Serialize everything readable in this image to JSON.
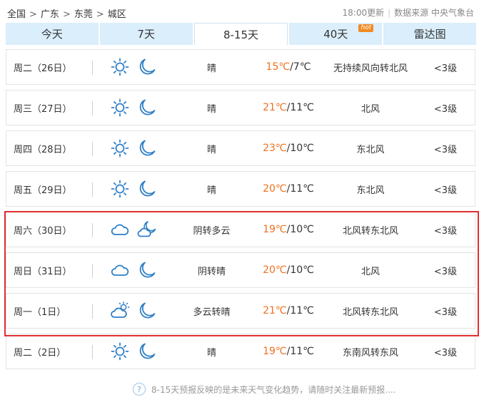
{
  "breadcrumb": [
    "全国",
    "广东",
    "东莞",
    "城区"
  ],
  "breadcrumb_sep": ">",
  "updated": "18:00更新",
  "source": "数据来源 中央气象台",
  "tabs": [
    {
      "label": "今天"
    },
    {
      "label": "7天"
    },
    {
      "label": "8-15天",
      "active": true
    },
    {
      "label": "40天",
      "badge": "hot"
    },
    {
      "label": "雷达图"
    }
  ],
  "rows": [
    {
      "day": "周二（26日）",
      "icon1": "sun-icon",
      "icon2": "moon-icon",
      "desc": "晴",
      "high": "15℃",
      "low": "/7℃",
      "wind": "无持续风向转北风",
      "level": "<3级"
    },
    {
      "day": "周三（27日）",
      "icon1": "sun-icon",
      "icon2": "moon-icon",
      "desc": "晴",
      "high": "21℃",
      "low": "/11℃",
      "wind": "北风",
      "level": "<3级"
    },
    {
      "day": "周四（28日）",
      "icon1": "sun-icon",
      "icon2": "moon-icon",
      "desc": "晴",
      "high": "23℃",
      "low": "/10℃",
      "wind": "东北风",
      "level": "<3级"
    },
    {
      "day": "周五（29日）",
      "icon1": "sun-icon",
      "icon2": "moon-icon",
      "desc": "晴",
      "high": "20℃",
      "low": "/11℃",
      "wind": "东北风",
      "level": "<3级"
    },
    {
      "day": "周六（30日）",
      "icon1": "cloud-icon",
      "icon2": "moon-cloud-icon",
      "desc": "阴转多云",
      "high": "19℃",
      "low": "/10℃",
      "wind": "北风转东北风",
      "level": "<3级"
    },
    {
      "day": "周日（31日）",
      "icon1": "cloud-icon",
      "icon2": "moon-icon",
      "desc": "阴转晴",
      "high": "20℃",
      "low": "/10℃",
      "wind": "北风",
      "level": "<3级"
    },
    {
      "day": "周一（1日）",
      "icon1": "sun-cloud-icon",
      "icon2": "moon-icon",
      "desc": "多云转晴",
      "high": "21℃",
      "low": "/11℃",
      "wind": "北风转东北风",
      "level": "<3级"
    },
    {
      "day": "周二（2日）",
      "icon1": "sun-icon",
      "icon2": "moon-icon",
      "desc": "晴",
      "high": "19℃",
      "low": "/11℃",
      "wind": "东南风转东风",
      "level": "<3级"
    }
  ],
  "footer": {
    "icon": "question-icon",
    "text": "8-15天预报反映的是未来天气变化趋势，请随时关注最新预报...."
  },
  "colors": {
    "tab_bg": "#daeefb",
    "high_temp": "#f0701e",
    "icon_blue": "#2f7fc6",
    "highlight": "#e03030"
  }
}
